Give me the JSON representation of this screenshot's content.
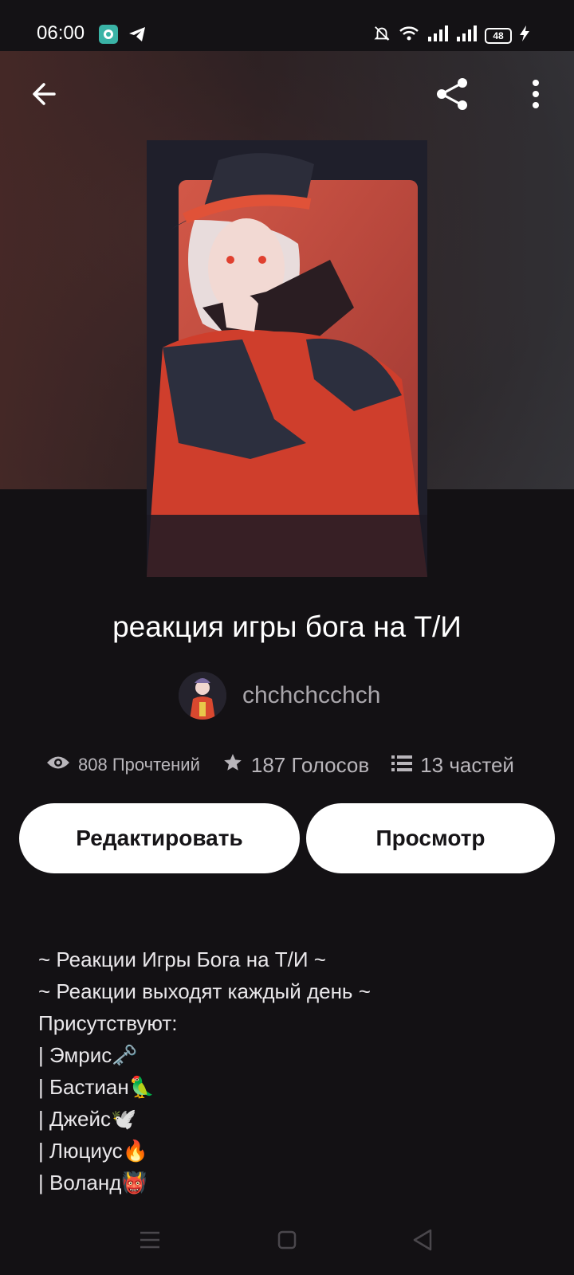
{
  "status_bar": {
    "time": "06:00",
    "battery": "48",
    "icons": [
      "cloud-app-icon",
      "telegram-icon",
      "mute-icon",
      "wifi-icon",
      "signal-icon",
      "signal-icon",
      "battery-icon",
      "charging-icon"
    ]
  },
  "toolbar": {
    "back_icon": "arrow-left-icon",
    "share_icon": "share-icon",
    "more_icon": "more-vertical-icon"
  },
  "story": {
    "title": "реакция игры бога на Т/И",
    "author": "chchchcchch",
    "stats": {
      "reads": "808 Прочтений",
      "votes": "187 Голосов",
      "parts": "13 частей"
    }
  },
  "actions": {
    "edit_label": "Редактировать",
    "view_label": "Просмотр"
  },
  "description": {
    "lines": [
      "~ Реакции Игры Бога на Т/И ~",
      "~ Реакции выходят каждый день ~",
      "Присутствуют:",
      "| Эмрис🗝️",
      "| Бастиан🦜",
      "| Джейс🕊️",
      "| Люциус🔥",
      "| Воланд👹"
    ]
  },
  "nav": {
    "menu_icon": "menu-icon",
    "home_icon": "home-square-icon",
    "back_icon": "back-triangle-icon"
  },
  "colors": {
    "background": "#131114",
    "button_bg": "#ffffff",
    "muted_text": "#a9a6ab"
  }
}
